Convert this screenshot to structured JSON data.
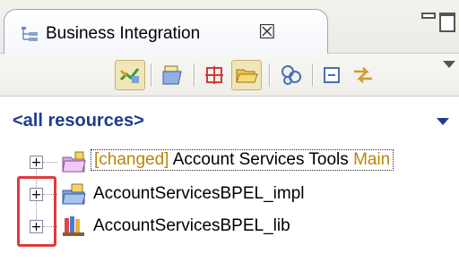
{
  "view": {
    "title": "Business Integration",
    "close_glyph": "☒"
  },
  "toolbar": {
    "buttons": [
      {
        "name": "link-with-editor-icon",
        "pressed": true
      },
      {
        "name": "open-editor-icon",
        "pressed": false
      },
      {
        "name": "show-categories-icon",
        "pressed": false
      },
      {
        "name": "show-folders-icon",
        "pressed": true
      },
      {
        "name": "show-dependencies-icon",
        "pressed": false
      },
      {
        "name": "collapse-all-icon",
        "pressed": false
      },
      {
        "name": "sync-icon",
        "pressed": false
      }
    ]
  },
  "filter": {
    "label": "<all resources>"
  },
  "tree": {
    "expand_glyph": "+",
    "items": [
      {
        "changed_tag": "[changed]",
        "name": "Account Services Tools",
        "branch": "Main",
        "type": "project"
      },
      {
        "name": "AccountServicesBPEL_impl",
        "type": "module"
      },
      {
        "name": "AccountServicesBPEL_lib",
        "type": "library"
      }
    ]
  },
  "colors": {
    "highlight": "#e03a3a",
    "filter_text": "#1d3c8f",
    "changed_text": "#b8860b"
  }
}
